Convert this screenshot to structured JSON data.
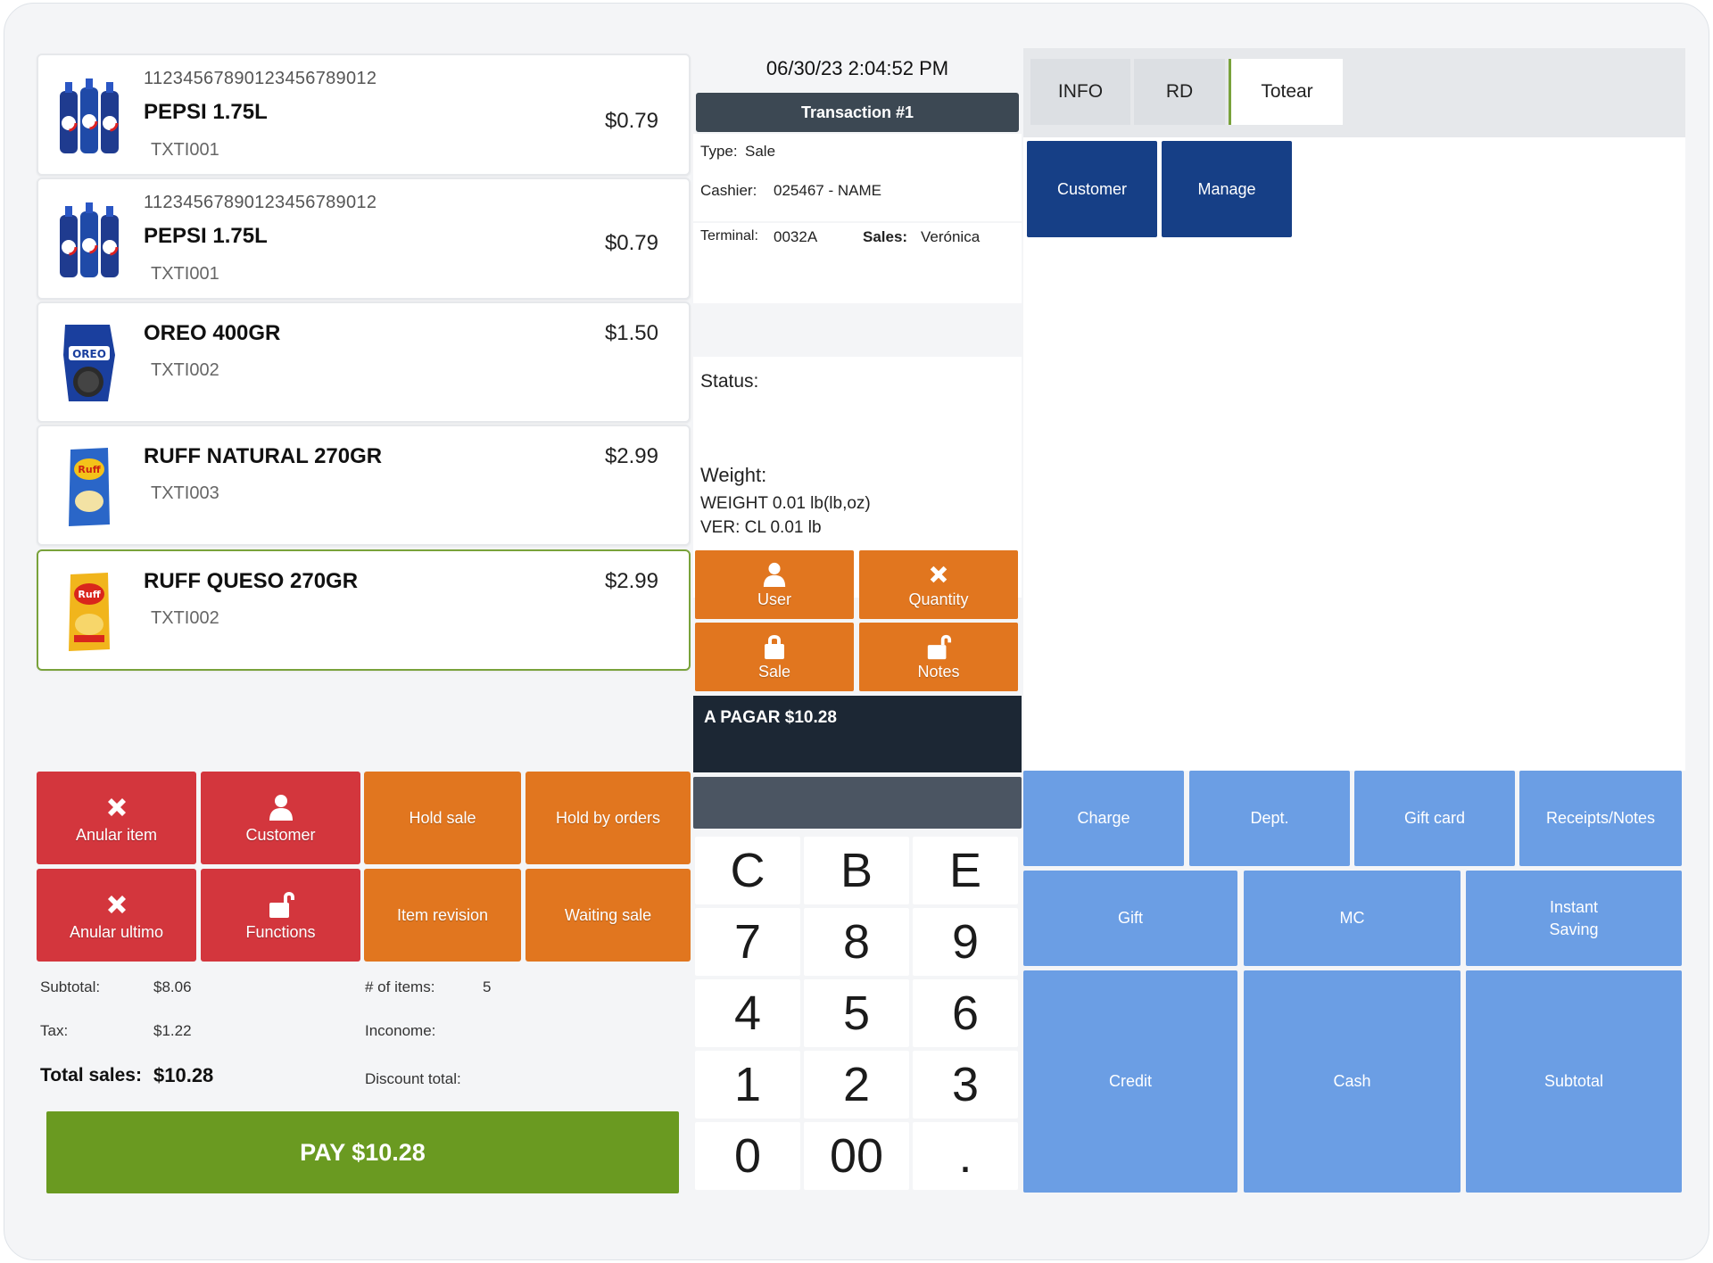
{
  "items": [
    {
      "barcode": "11234567890123456789012",
      "name": "PEPSI 1.75L",
      "code": "TXTI001",
      "price": "$0.79",
      "image": "pepsi-image"
    },
    {
      "barcode": "11234567890123456789012",
      "name": "PEPSI 1.75L",
      "code": "TXTI001",
      "price": "$0.79",
      "image": "pepsi-image"
    },
    {
      "barcode": "",
      "name": "OREO 400GR",
      "code": "TXTI002",
      "price": "$1.50",
      "image": "oreo-image"
    },
    {
      "barcode": "",
      "name": "RUFF NATURAL 270GR",
      "code": "TXTI003",
      "price": "$2.99",
      "image": "ruff-natural-image"
    },
    {
      "barcode": "",
      "name": "RUFF QUESO 270GR",
      "code": "TXTI002",
      "price": "$2.99",
      "image": "ruff-queso-image",
      "selected": true
    }
  ],
  "actions": {
    "anular_item": "Anular item",
    "customer": "Customer",
    "hold_sale": "Hold sale",
    "hold_by_orders": "Hold by orders",
    "anular_ultimo": "Anular ultimo",
    "functions": "Functions",
    "item_revision": "Item revision",
    "waiting_sale": "Waiting sale"
  },
  "totals": {
    "subtotal_label": "Subtotal:",
    "subtotal_value": "$8.06",
    "tax_label": "Tax:",
    "tax_value": "$1.22",
    "total_sales_label": "Total sales:",
    "total_sales_value": "$10.28",
    "items_label": "# of items:",
    "items_value": "5",
    "inconome_label": "Inconome:",
    "discount_label": "Discount total:"
  },
  "pay_button": "PAY $10.28",
  "transaction": {
    "datetime": "06/30/23 2:04:52 PM",
    "title": "Transaction #1",
    "type_label": "Type:",
    "type_value": "Sale",
    "cashier_label": "Cashier:",
    "cashier_value": "025467 - NAME",
    "terminal_label": "Terminal:",
    "terminal_value": "0032A",
    "sales_label": "Sales:",
    "sales_value": "Verónica",
    "status_label": "Status:",
    "weight_label": "Weight:",
    "weight_line1": "WEIGHT 0.01 lb(lb,oz)",
    "weight_line2": "VER: CL 0.01 lb"
  },
  "mid_buttons": {
    "user": "User",
    "quantity": "Quantity",
    "sale": "Sale",
    "notes": "Notes"
  },
  "amount_due": "A PAGAR $10.28",
  "keypad": [
    "C",
    "B",
    "E",
    "7",
    "8",
    "9",
    "4",
    "5",
    "6",
    "1",
    "2",
    "3",
    "0",
    "00",
    "."
  ],
  "tabs": [
    "INFO",
    "RD",
    "Totear"
  ],
  "panel_buttons": {
    "customer": "Customer",
    "manage": "Manage"
  },
  "payment_buttons": {
    "charge": "Charge",
    "dept": "Dept.",
    "gift_card": "Gift card",
    "receipts_notes": "Receipts/Notes",
    "gift": "Gift",
    "mc": "MC",
    "instant_saving_line1": "Instant",
    "instant_saving_line2": "Saving",
    "credit": "Credit",
    "cash": "Cash",
    "subtotal": "Subtotal"
  },
  "colors": {
    "red": "#d3363d",
    "orange": "#e1761f",
    "green": "#6a9a21",
    "navy": "#163f86",
    "light_blue": "#6b9ee4",
    "dark": "#1c2734"
  }
}
